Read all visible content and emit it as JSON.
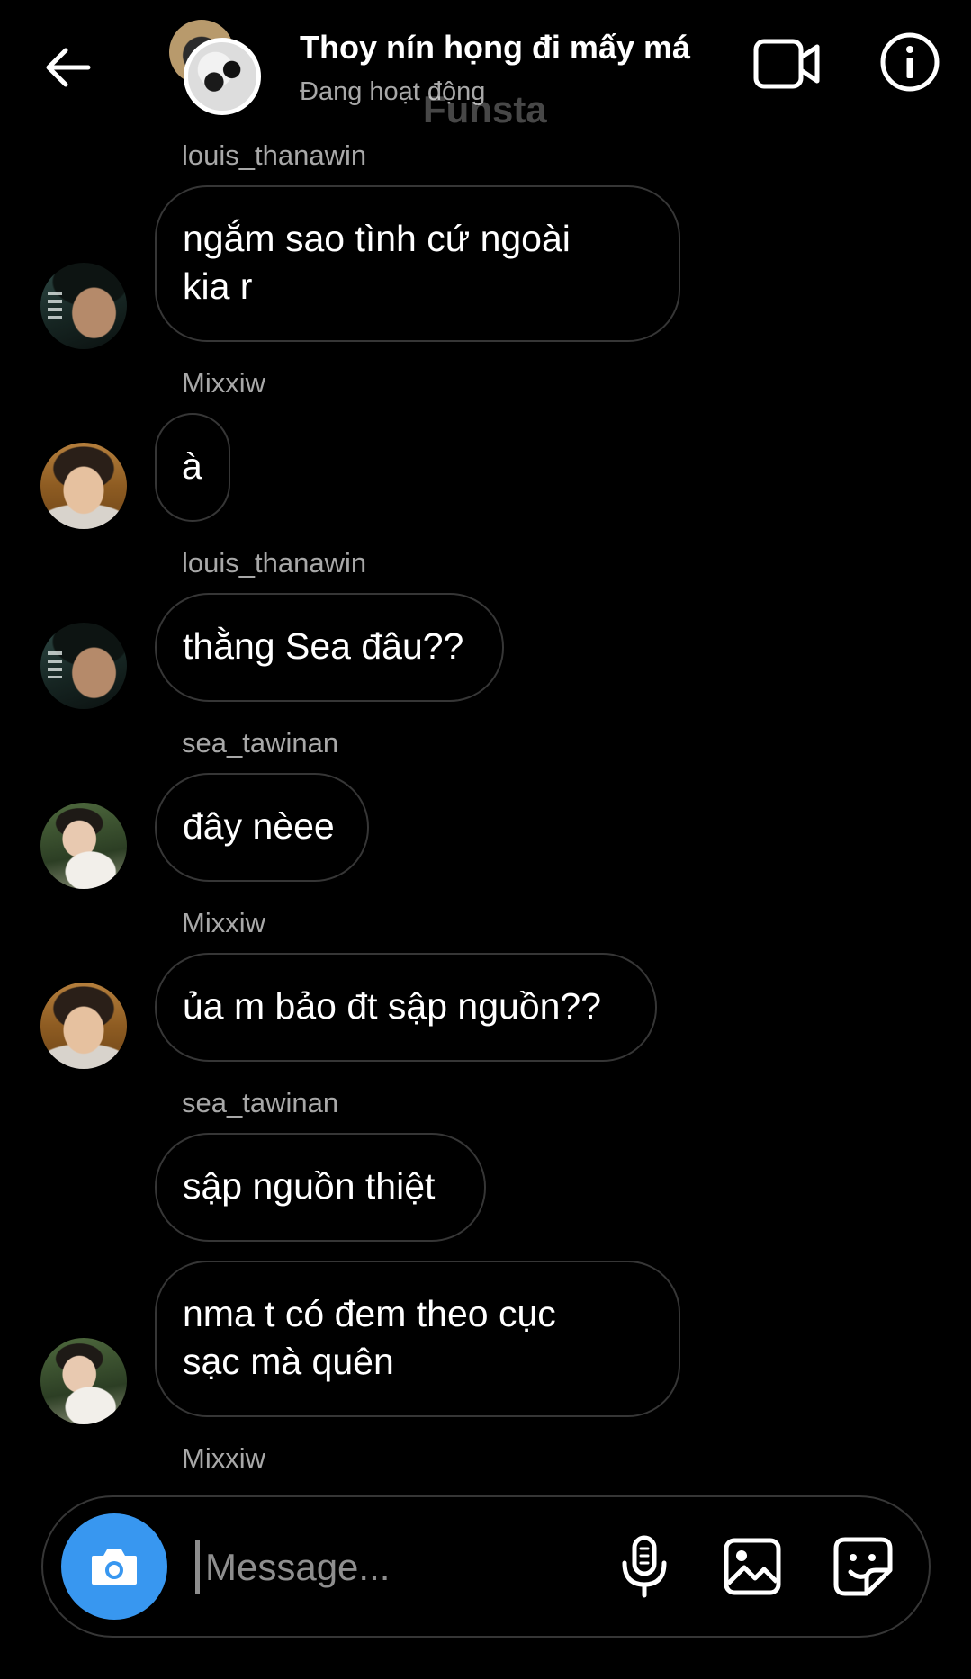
{
  "header": {
    "title": "Thoy nín họng đi mấy má",
    "status": "Đang hoạt động",
    "watermark": "Funsta"
  },
  "messages": [
    {
      "sender": "louis_thanawin",
      "text": "ngắm sao tình cứ ngoài\nkia r",
      "avatar": "louis_thanawin"
    },
    {
      "sender": "Mixxiw",
      "text": "à",
      "avatar": "Mixxiw"
    },
    {
      "sender": "louis_thanawin",
      "text": "thằng Sea đâu??",
      "avatar": "louis_thanawin"
    },
    {
      "sender": "sea_tawinan",
      "text": "đây nèee",
      "avatar": "sea_tawinan"
    },
    {
      "sender": "Mixxiw",
      "text": "ủa m bảo đt sập nguồn??",
      "avatar": "Mixxiw"
    },
    {
      "sender": "sea_tawinan",
      "text": "sập nguồn thiệt",
      "avatar": null
    },
    {
      "sender": null,
      "text": "nma t có đem theo cục\nsạc mà quên",
      "avatar": "sea_tawinan"
    },
    {
      "sender": "Mixxiw",
      "text": null,
      "avatar": null
    }
  ],
  "composer": {
    "placeholder": "Message..."
  },
  "icons": {
    "back": "arrow-left-icon",
    "video": "video-camera-icon",
    "info": "info-icon",
    "camera": "camera-icon",
    "mic": "microphone-icon",
    "gallery": "image-gallery-icon",
    "sticker": "sticker-icon"
  },
  "colors": {
    "background": "#000000",
    "text_primary": "#ffffff",
    "text_secondary": "#a8a8a8",
    "bubble_border": "#363636",
    "camera_button": "#3897f0"
  }
}
